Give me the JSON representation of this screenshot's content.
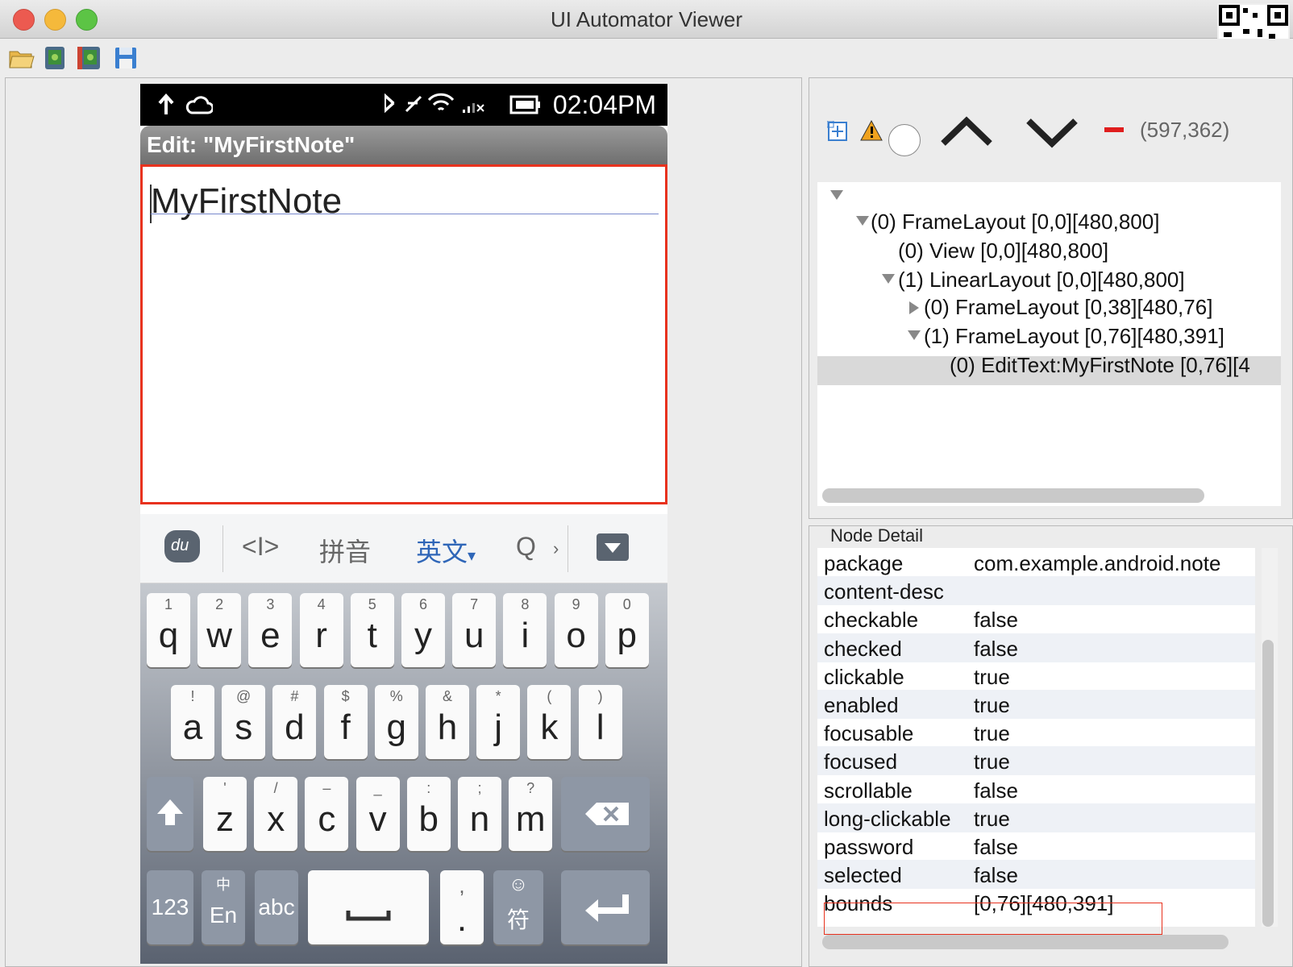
{
  "window": {
    "title": "UI Automator Viewer"
  },
  "phone": {
    "status_time": "02:04PM",
    "app_title": "Edit: \"MyFirstNote\"",
    "note_text": "MyFirstNote",
    "ime": {
      "cursor": "<I>",
      "pinyin": "拼音",
      "english": "英文",
      "english_arrow": "▾",
      "search": "Q",
      "more": "›"
    },
    "keyboard": {
      "row1": [
        {
          "hint": "1",
          "key": "q"
        },
        {
          "hint": "2",
          "key": "w"
        },
        {
          "hint": "3",
          "key": "e"
        },
        {
          "hint": "4",
          "key": "r"
        },
        {
          "hint": "5",
          "key": "t"
        },
        {
          "hint": "6",
          "key": "y"
        },
        {
          "hint": "7",
          "key": "u"
        },
        {
          "hint": "8",
          "key": "i"
        },
        {
          "hint": "9",
          "key": "o"
        },
        {
          "hint": "0",
          "key": "p"
        }
      ],
      "row2": [
        {
          "hint": "!",
          "key": "a"
        },
        {
          "hint": "@",
          "key": "s"
        },
        {
          "hint": "#",
          "key": "d"
        },
        {
          "hint": "$",
          "key": "f"
        },
        {
          "hint": "%",
          "key": "g"
        },
        {
          "hint": "&",
          "key": "h"
        },
        {
          "hint": "*",
          "key": "j"
        },
        {
          "hint": "(",
          "key": "k"
        },
        {
          "hint": ")",
          "key": "l"
        }
      ],
      "row3": [
        {
          "hint": "'",
          "key": "z"
        },
        {
          "hint": "/",
          "key": "x"
        },
        {
          "hint": "–",
          "key": "c"
        },
        {
          "hint": "_",
          "key": "v"
        },
        {
          "hint": ":",
          "key": "b"
        },
        {
          "hint": ";",
          "key": "n"
        },
        {
          "hint": "?",
          "key": "m"
        }
      ],
      "num": "123",
      "lang_top": "中",
      "lang_bottom": "En",
      "abc": "abc",
      "punct_top": ",",
      "punct_bottom": ".",
      "emoji_top": "☺",
      "emoji_bottom": "符"
    }
  },
  "toolbar_coords": "(597,362)",
  "tree": [
    "(0) FrameLayout [0,0][480,800]",
    "(0) View [0,0][480,800]",
    "(1) LinearLayout [0,0][480,800]",
    "(0) FrameLayout [0,38][480,76]",
    "(1) FrameLayout [0,76][480,391]",
    "(0) EditText:MyFirstNote [0,76][4"
  ],
  "node_detail": {
    "header": "Node Detail",
    "rows": [
      {
        "key": "package",
        "value": "com.example.android.note"
      },
      {
        "key": "content-desc",
        "value": ""
      },
      {
        "key": "checkable",
        "value": "false"
      },
      {
        "key": "checked",
        "value": "false"
      },
      {
        "key": "clickable",
        "value": "true"
      },
      {
        "key": "enabled",
        "value": "true"
      },
      {
        "key": "focusable",
        "value": "true"
      },
      {
        "key": "focused",
        "value": "true"
      },
      {
        "key": "scrollable",
        "value": "false"
      },
      {
        "key": "long-clickable",
        "value": "true"
      },
      {
        "key": "password",
        "value": "false"
      },
      {
        "key": "selected",
        "value": "false"
      },
      {
        "key": "bounds",
        "value": "[0,76][480,391]"
      }
    ]
  },
  "colors": {
    "highlight": "#e8321e",
    "selection": "#d9d9d9",
    "tree_bg": "#ffffff"
  }
}
